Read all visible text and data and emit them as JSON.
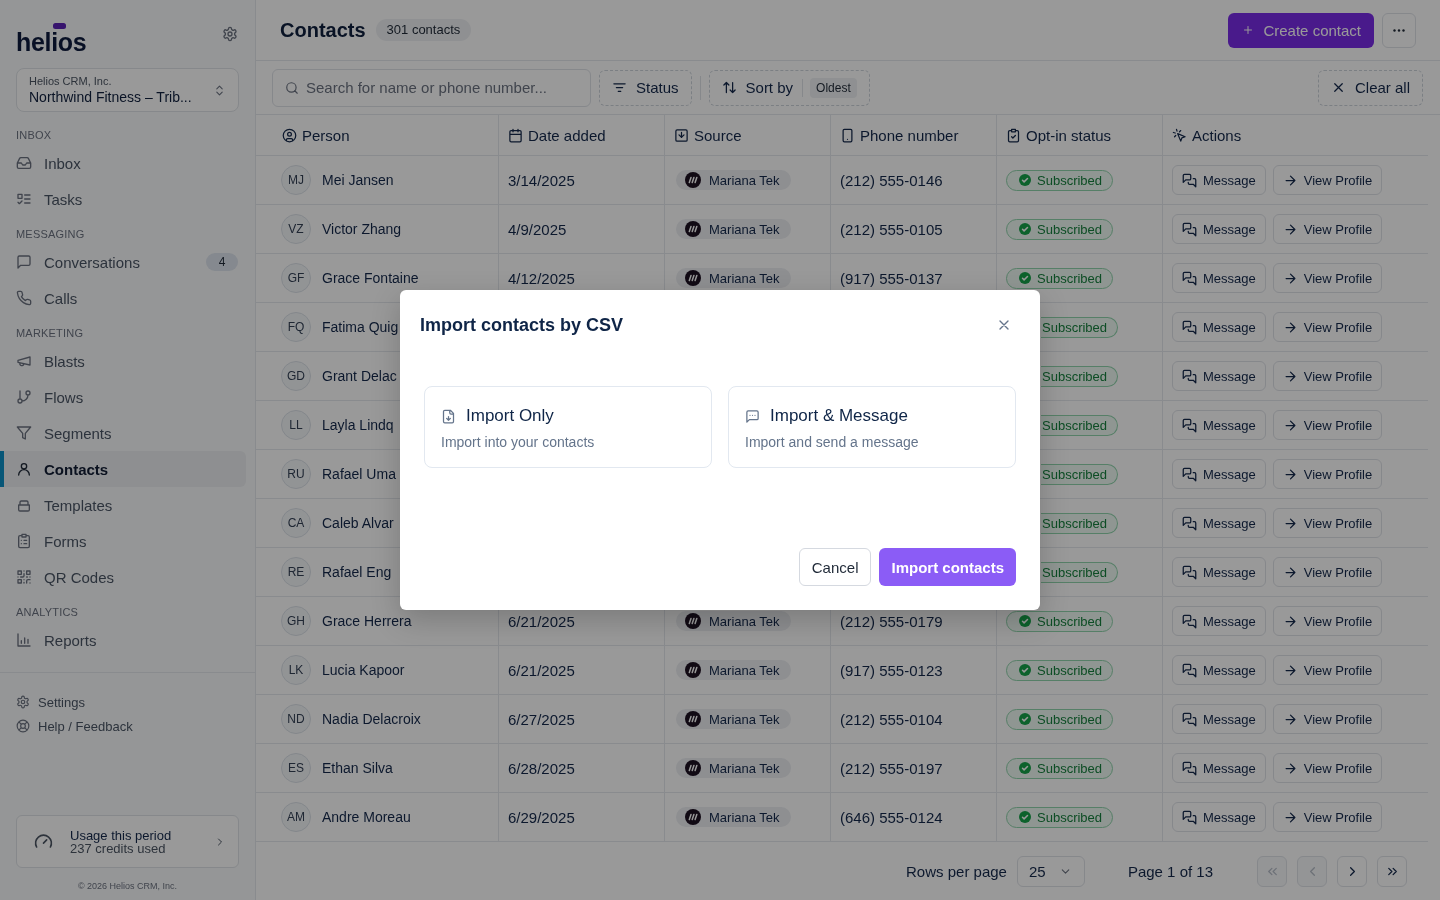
{
  "sidebar": {
    "logo": "helios",
    "workspace": {
      "organization": "Helios CRM, Inc.",
      "name": "Northwind Fitness – Trib..."
    },
    "sections": [
      {
        "heading": "INBOX",
        "items": [
          {
            "label": "Inbox",
            "selected": false
          },
          {
            "label": "Tasks",
            "selected": false
          }
        ]
      },
      {
        "heading": "MESSAGING",
        "items": [
          {
            "label": "Conversations",
            "selected": false,
            "badge": "4"
          },
          {
            "label": "Calls",
            "selected": false
          }
        ]
      },
      {
        "heading": "MARKETING",
        "items": [
          {
            "label": "Blasts",
            "selected": false
          },
          {
            "label": "Flows",
            "selected": false
          },
          {
            "label": "Segments",
            "selected": false
          },
          {
            "label": "Contacts",
            "selected": true
          },
          {
            "label": "Templates",
            "selected": false
          },
          {
            "label": "Forms",
            "selected": false
          },
          {
            "label": "QR Codes",
            "selected": false
          }
        ]
      },
      {
        "heading": "ANALYTICS",
        "items": [
          {
            "label": "Reports",
            "selected": false
          }
        ]
      }
    ],
    "footer_links": [
      "Settings",
      "Help / Feedback"
    ],
    "usage": {
      "title": "Usage this period",
      "detail": "237 credits used"
    },
    "copyright": "© 2026 Helios CRM, Inc."
  },
  "header": {
    "title": "Contacts",
    "count": "301 contacts",
    "create_button": "Create contact"
  },
  "toolbar": {
    "search": {
      "placeholder": "Search for name or phone number..."
    },
    "status_filter": "Status",
    "sort": {
      "label": "Sort by",
      "value": "Oldest"
    },
    "clear": "Clear all"
  },
  "table": {
    "columns": [
      "Person",
      "Date added",
      "Source",
      "Phone number",
      "Opt-in status",
      "Actions"
    ],
    "rows": [
      {
        "initials": "MJ",
        "name": "Mei Jansen",
        "date": "3/14/2025",
        "source": "Mariana Tek",
        "phone": "(212) 555-0146",
        "status": "Subscribed",
        "actions": [
          "Message",
          "View Profile"
        ]
      },
      {
        "initials": "VZ",
        "name": "Victor Zhang",
        "date": "4/9/2025",
        "source": "Mariana Tek",
        "phone": "(212) 555-0105",
        "status": "Subscribed",
        "actions": [
          "Message",
          "View Profile"
        ]
      },
      {
        "initials": "GF",
        "name": "Grace Fontaine",
        "date": "4/12/2025",
        "source": "Mariana Tek",
        "phone": "(917) 555-0137",
        "status": "Subscribed",
        "actions": [
          "Message",
          "View Profile"
        ]
      },
      {
        "initials": "FQ",
        "name": "Fatima Quig",
        "status": "Subscribed",
        "actions": [
          "Message",
          "View Profile"
        ]
      },
      {
        "initials": "GD",
        "name": "Grant Delac",
        "status": "Subscribed",
        "actions": [
          "Message",
          "View Profile"
        ]
      },
      {
        "initials": "LL",
        "name": "Layla Lindq",
        "status": "Subscribed",
        "actions": [
          "Message",
          "View Profile"
        ]
      },
      {
        "initials": "RU",
        "name": "Rafael Uma",
        "status": "Subscribed",
        "actions": [
          "Message",
          "View Profile"
        ]
      },
      {
        "initials": "CA",
        "name": "Caleb Alvar",
        "status": "Subscribed",
        "actions": [
          "Message",
          "View Profile"
        ]
      },
      {
        "initials": "RE",
        "name": "Rafael Eng",
        "status": "Subscribed",
        "actions": [
          "Message",
          "View Profile"
        ]
      },
      {
        "initials": "GH",
        "name": "Grace Herrera",
        "date": "6/21/2025",
        "source": "Mariana Tek",
        "phone": "(212) 555-0179",
        "status": "Subscribed",
        "actions": [
          "Message",
          "View Profile"
        ]
      },
      {
        "initials": "LK",
        "name": "Lucia Kapoor",
        "date": "6/21/2025",
        "source": "Mariana Tek",
        "phone": "(917) 555-0123",
        "status": "Subscribed",
        "actions": [
          "Message",
          "View Profile"
        ]
      },
      {
        "initials": "ND",
        "name": "Nadia Delacroix",
        "date": "6/27/2025",
        "source": "Mariana Tek",
        "phone": "(212) 555-0104",
        "status": "Subscribed",
        "actions": [
          "Message",
          "View Profile"
        ]
      },
      {
        "initials": "ES",
        "name": "Ethan Silva",
        "date": "6/28/2025",
        "source": "Mariana Tek",
        "phone": "(212) 555-0197",
        "status": "Subscribed",
        "actions": [
          "Message",
          "View Profile"
        ]
      },
      {
        "initials": "AM",
        "name": "Andre Moreau",
        "date": "6/29/2025",
        "source": "Mariana Tek",
        "phone": "(646) 555-0124",
        "status": "Subscribed",
        "actions": [
          "Message",
          "View Profile"
        ]
      }
    ]
  },
  "pagination": {
    "rows_label": "Rows per page",
    "rows_value": "25",
    "page": "Page 1 of 13",
    "buttons": [
      {
        "disabled": true
      },
      {
        "disabled": true
      },
      {
        "disabled": false
      },
      {
        "disabled": false
      }
    ]
  },
  "modal": {
    "title": "Import contacts by CSV",
    "options": [
      {
        "title": "Import Only",
        "description": "Import into your contacts"
      },
      {
        "title": "Import & Message",
        "description": "Import and send a message"
      }
    ],
    "buttons": [
      {
        "label": "Cancel",
        "kind": "secondary"
      },
      {
        "label": "Import contacts",
        "kind": "primary"
      }
    ]
  }
}
